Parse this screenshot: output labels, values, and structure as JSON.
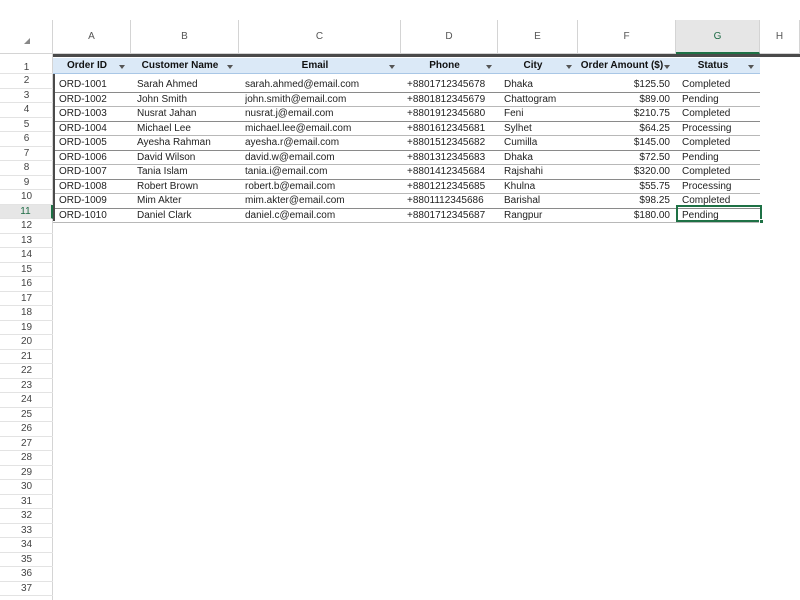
{
  "columns": [
    {
      "letter": "A"
    },
    {
      "letter": "B"
    },
    {
      "letter": "C"
    },
    {
      "letter": "D"
    },
    {
      "letter": "E"
    },
    {
      "letter": "F"
    },
    {
      "letter": "G"
    },
    {
      "letter": "H"
    }
  ],
  "table": {
    "headers": [
      "Order ID",
      "Customer Name",
      "Email",
      "Phone",
      "City",
      "Order Amount ($)",
      "Status"
    ],
    "rows": [
      [
        "ORD-1001",
        "Sarah Ahmed",
        "sarah.ahmed@email.com",
        "+8801712345678",
        "Dhaka",
        "$125.50",
        "Completed"
      ],
      [
        "ORD-1002",
        "John Smith",
        "john.smith@email.com",
        "+8801812345679",
        "Chattogram",
        "$89.00",
        "Pending"
      ],
      [
        "ORD-1003",
        "Nusrat Jahan",
        "nusrat.j@email.com",
        "+8801912345680",
        "Feni",
        "$210.75",
        "Completed"
      ],
      [
        "ORD-1004",
        "Michael Lee",
        "michael.lee@email.com",
        "+8801612345681",
        "Sylhet",
        "$64.25",
        "Processing"
      ],
      [
        "ORD-1005",
        "Ayesha Rahman",
        "ayesha.r@email.com",
        "+8801512345682",
        "Cumilla",
        "$145.00",
        "Completed"
      ],
      [
        "ORD-1006",
        "David Wilson",
        "david.w@email.com",
        "+8801312345683",
        "Dhaka",
        "$72.50",
        "Pending"
      ],
      [
        "ORD-1007",
        "Tania Islam",
        "tania.i@email.com",
        "+8801412345684",
        "Rajshahi",
        "$320.00",
        "Completed"
      ],
      [
        "ORD-1008",
        "Robert Brown",
        "robert.b@email.com",
        "+8801212345685",
        "Khulna",
        "$55.75",
        "Processing"
      ],
      [
        "ORD-1009",
        "Mim Akter",
        "mim.akter@email.com",
        "+8801112345686",
        "Barishal",
        "$98.25",
        "Completed"
      ],
      [
        "ORD-1010",
        "Daniel Clark",
        "daniel.c@email.com",
        "+8801712345687",
        "Rangpur",
        "$180.00",
        "Pending"
      ]
    ]
  },
  "row_numbers": [
    "1",
    "2",
    "3",
    "4",
    "5",
    "6",
    "7",
    "8",
    "9",
    "10",
    "11",
    "12",
    "13",
    "14",
    "15",
    "16",
    "17",
    "18",
    "19",
    "20",
    "21",
    "22",
    "23",
    "24",
    "25",
    "26",
    "27",
    "28",
    "29",
    "30",
    "31",
    "32",
    "33",
    "34",
    "35",
    "36",
    "37"
  ],
  "selection": {
    "cell": "G11",
    "value": "Pending"
  },
  "colors": {
    "accent": "#1e7145",
    "table_header": "#dbe9f7",
    "grid": "#d4d4d4"
  },
  "icons": {
    "corner": "select-all-triangle-icon",
    "filter": "filter-dropdown-icon"
  }
}
